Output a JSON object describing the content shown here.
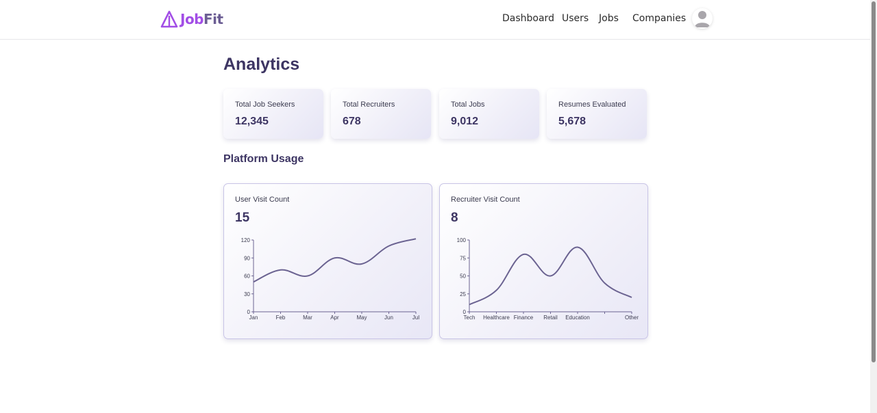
{
  "brand": {
    "logo_part1": "Job",
    "logo_part2": "Fit",
    "accent": "#a24ee6",
    "secondary": "#6b5d93",
    "logo_icon": "triangle-logo-icon"
  },
  "nav": {
    "items": [
      {
        "label": "Dashboard"
      },
      {
        "label": "Users"
      },
      {
        "label": "Jobs"
      },
      {
        "label": "Companies"
      }
    ],
    "avatar_icon": "user-avatar-icon"
  },
  "page": {
    "title": "Analytics",
    "section_title": "Platform Usage"
  },
  "stats": [
    {
      "label": "Total Job Seekers",
      "value": "12,345"
    },
    {
      "label": "Total Recruiters",
      "value": "678"
    },
    {
      "label": "Total Jobs",
      "value": "9,012"
    },
    {
      "label": "Resumes Evaluated",
      "value": "5,678"
    }
  ],
  "cards": [
    {
      "title": "User Visit Count",
      "count": "15"
    },
    {
      "title": "Recruiter Visit Count",
      "count": "8"
    }
  ],
  "chart_data": [
    {
      "type": "line",
      "title": "User Visit Count",
      "x": [
        "Jan",
        "Feb",
        "Mar",
        "Apr",
        "May",
        "Jun",
        "Jul"
      ],
      "values": [
        50,
        70,
        60,
        90,
        80,
        110,
        122
      ],
      "ylim": [
        0,
        120
      ],
      "yticks": [
        0,
        30,
        60,
        90,
        120
      ],
      "line_color": "#6b6391",
      "grid": false
    },
    {
      "type": "line",
      "title": "Recruiter Visit Count",
      "x": [
        "Tech",
        "Healthcare",
        "Finance",
        "Retail",
        "Education",
        "",
        "Other"
      ],
      "values": [
        10,
        30,
        80,
        50,
        90,
        40,
        20
      ],
      "ylim": [
        0,
        100
      ],
      "yticks": [
        0,
        25,
        50,
        75,
        100
      ],
      "line_color": "#6b6391",
      "grid": false
    }
  ]
}
